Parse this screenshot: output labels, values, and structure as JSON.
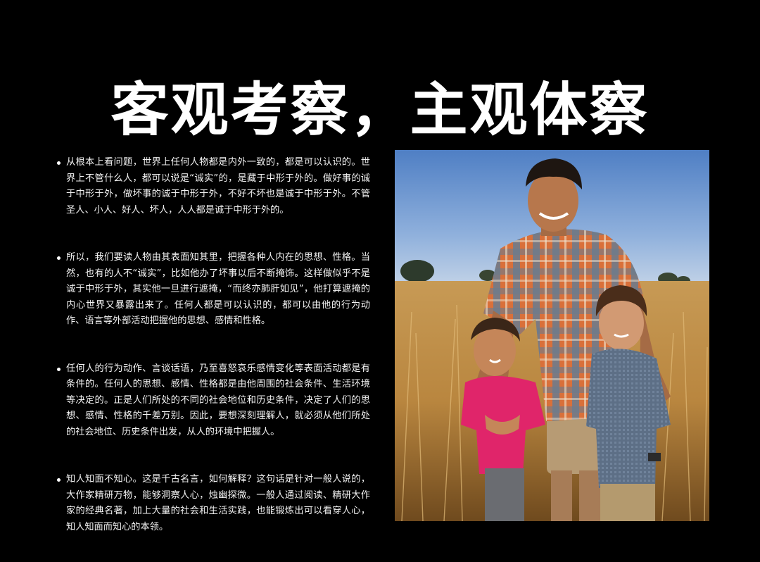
{
  "title": "客观考察，主观体察",
  "bullets": [
    "从根本上看问题，世界上任何人物都是内外一致的，都是可以认识的。世界上不管什么人，都可以说是“诚实”的，是藏于中形于外的。做好事的诚于中形于外，做坏事的诚于中形于外，不好不坏也是诚于中形于外。不管圣人、小人、好人、坏人，人人都是诚于中形于外的。",
    "所以，我们要读人物由其表面知其里，把握各种人内在的思想、性格。当然，也有的人不“诚实”，比如他办了坏事以后不断掩饰。这样做似乎不是诚于中形于外，其实他一旦进行遮掩，“而终亦肺肝如见”，他打算遮掩的内心世界又暴露出来了。任何人都是可以认识的，都可以由他的行为动作、语言等外部活动把握他的思想、感情和性格。",
    "任何人的行为动作、言谈话语，乃至喜怒哀乐感情变化等表面活动都是有条件的。任何人的思想、感情、性格都是由他周围的社会条件、生活环境等决定的。正是人们所处的不同的社会地位和历史条件，决定了人们的思想、感情、性格的千差万别。因此，要想深刻理解人，就必须从他们所处的社会地位、历史条件出发，从人的环境中把握人。",
    "知人知面不知心。这是千古名言，如何解释？这句话是针对一般人说的，大作家精研万物，能够洞察人心，烛幽探微。一般人通过阅读、精研大作家的经典名著，加上大量的社会和生活实践，也能锻炼出可以看穿人心，知人知面而知心的本领。"
  ],
  "photo": {
    "subject": "family-photo"
  },
  "colors": {
    "background": "#000000",
    "text": "#ffffff"
  }
}
